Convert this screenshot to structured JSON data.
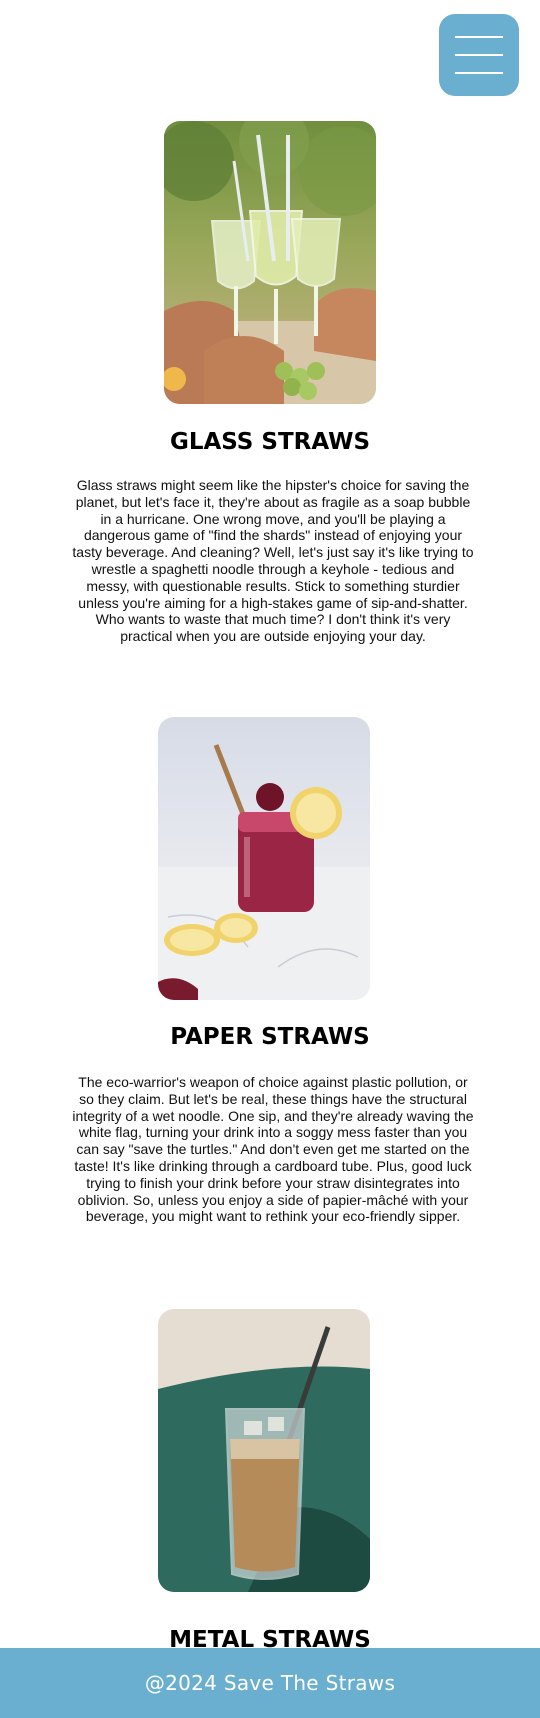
{
  "menu": {
    "icon": "hamburger-menu-icon",
    "color": "#6aafd0"
  },
  "sections": [
    {
      "title": "GLASS STRAWS",
      "image": "glass-straws-photo",
      "text": "Glass straws might seem like the hipster's choice for saving the planet, but let's face it, they're about as fragile as a soap bubble in a hurricane. One wrong move, and you'll be playing a dangerous game of \"find the shards\" instead of enjoying your tasty beverage. And cleaning? Well, let's just say it's like trying to wrestle a spaghetti noodle through a keyhole - tedious and messy, with questionable results. Stick to something sturdier unless you're aiming for a high-stakes game of sip-and-shatter. Who wants to waste that much time? I don't think it's very practical when you are outside enjoying your day."
    },
    {
      "title": "PAPER STRAWS",
      "image": "paper-straws-photo",
      "text": "The eco-warrior's weapon of choice against plastic pollution, or so they claim. But let's be real, these things have the structural integrity of a wet noodle. One sip, and they're already waving the white flag, turning your drink into a soggy mess faster than you can say \"save the turtles.\" And don't even get me started on the taste! It's like drinking through a cardboard tube. Plus, good luck trying to finish your drink before your straw disintegrates into oblivion. So, unless you enjoy a side of papier-mâché with your beverage, you might want to rethink your eco-friendly sipper."
    },
    {
      "title": "METAL STRAWS",
      "image": "metal-straws-photo"
    }
  ],
  "footer": {
    "text": "@2024 Save The Straws",
    "color": "#6aafd0"
  }
}
